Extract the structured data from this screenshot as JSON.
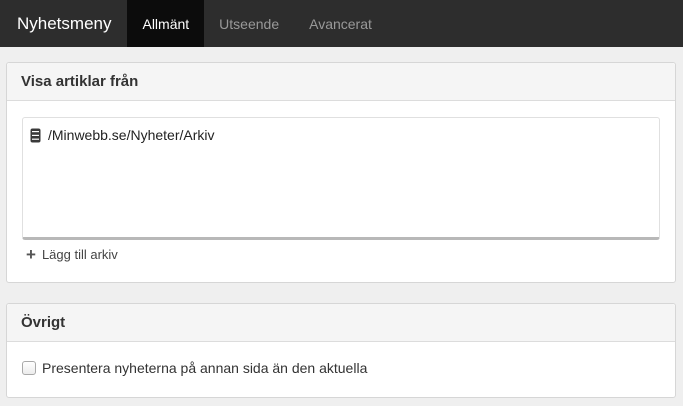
{
  "topbar": {
    "title": "Nyhetsmeny",
    "tabs": [
      {
        "label": "Allmänt",
        "active": true
      },
      {
        "label": "Utseende",
        "active": false
      },
      {
        "label": "Avancerat",
        "active": false
      }
    ]
  },
  "articles_panel": {
    "title": "Visa artiklar från",
    "archives": [
      {
        "icon": "database-icon",
        "path": "/Minwebb.se/Nyheter/Arkiv"
      }
    ],
    "add_label": "Lägg till arkiv",
    "add_icon": "plus-icon"
  },
  "other_panel": {
    "title": "Övrigt",
    "checkbox_label": "Presentera nyheterna på annan sida än den aktuella",
    "checkbox_checked": false
  },
  "colors": {
    "topbar": "#2d2d2d",
    "active_tab": "#0c0c0c",
    "background": "#efefef"
  }
}
